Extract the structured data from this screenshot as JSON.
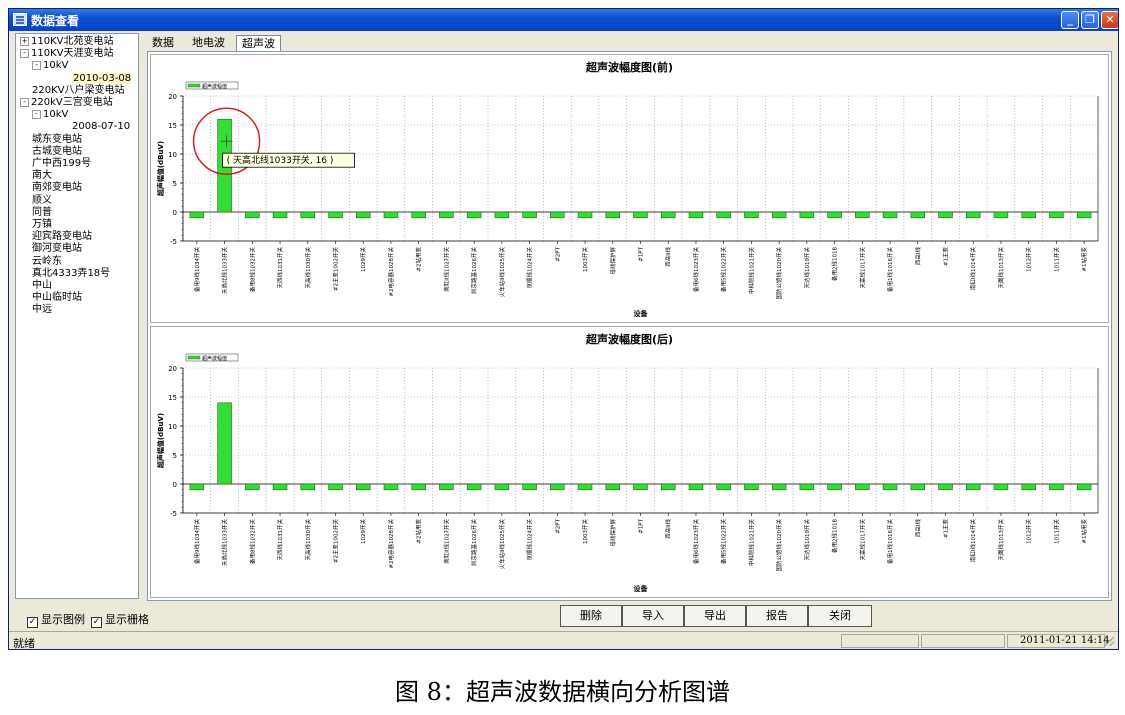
{
  "window": {
    "title": "数据查看"
  },
  "tree": [
    {
      "label": "110KV北苑变电站",
      "depth": 0,
      "toggle": "+"
    },
    {
      "label": "110KV天涯变电站",
      "depth": 0,
      "toggle": "-"
    },
    {
      "label": "10kV",
      "depth": 1,
      "toggle": "-"
    },
    {
      "label": "2010-03-08",
      "depth": 2,
      "toggle": "",
      "selected": true
    },
    {
      "label": "220KV八户梁变电站",
      "depth": 0,
      "toggle": ""
    },
    {
      "label": "220kV三宫变电站",
      "depth": 0,
      "toggle": "-"
    },
    {
      "label": "10kV",
      "depth": 1,
      "toggle": "-"
    },
    {
      "label": "2008-07-10",
      "depth": 2,
      "toggle": ""
    },
    {
      "label": "城东变电站",
      "depth": 0,
      "toggle": ""
    },
    {
      "label": "古城变电站",
      "depth": 0,
      "toggle": ""
    },
    {
      "label": "广中西199号",
      "depth": 0,
      "toggle": ""
    },
    {
      "label": "南大",
      "depth": 0,
      "toggle": ""
    },
    {
      "label": "南郊变电站",
      "depth": 0,
      "toggle": ""
    },
    {
      "label": "顺义",
      "depth": 0,
      "toggle": ""
    },
    {
      "label": "同普",
      "depth": 0,
      "toggle": ""
    },
    {
      "label": "万镇",
      "depth": 0,
      "toggle": ""
    },
    {
      "label": "迎宾路变电站",
      "depth": 0,
      "toggle": ""
    },
    {
      "label": "御河变电站",
      "depth": 0,
      "toggle": ""
    },
    {
      "label": "云岭东",
      "depth": 0,
      "toggle": ""
    },
    {
      "label": "真北4333弄18号",
      "depth": 0,
      "toggle": ""
    },
    {
      "label": "中山",
      "depth": 0,
      "toggle": ""
    },
    {
      "label": "中山临时站",
      "depth": 0,
      "toggle": ""
    },
    {
      "label": "中远",
      "depth": 0,
      "toggle": ""
    }
  ],
  "tabs": [
    "数据",
    "地电波",
    "超声波"
  ],
  "active_tab": 2,
  "chart_data": [
    {
      "type": "bar",
      "title": "超声波幅度图(前)",
      "xlabel": "设备",
      "ylabel": "超声幅值(dBuV)",
      "ylim": [
        -5,
        20
      ],
      "yticks": [
        -5,
        0,
        5,
        10,
        15,
        20
      ],
      "grid": true,
      "legend": {
        "label": "超声波幅值",
        "placement": "top-left"
      },
      "series": [
        {
          "name": "超声波幅值",
          "color": "#33dd33"
        }
      ],
      "categories": [
        "备用9线1034开关",
        "天高北线1033开关",
        "备用8线1032开关",
        "天西线1031开关",
        "天高线1030开关",
        "#2主变1002开关",
        "1029开关",
        "#2电容器1028开关",
        "#2站用变",
        "南缸II线1027开关",
        "凯京路基1026开关",
        "火车站II线1025开关",
        "京顺线1024开关",
        "#2PT",
        "1003开关",
        "母线保护屏",
        "#1PT",
        "西岳II线",
        "备用6线1023开关",
        "备用5线1022开关",
        "中科院线1021开关",
        "国防公馆线1020开关",
        "天达线1019开关",
        "备用2线1018",
        "天富线1017开关",
        "备用1线1016开关",
        "西岳I线",
        "#1主变",
        "南缸I线1014开关",
        "天鹰线1013开关",
        "1012开关",
        "1011开关",
        "#1站用变"
      ],
      "values": [
        -1,
        16,
        -1,
        -1,
        -1,
        -1,
        -1,
        -1,
        -1,
        -1,
        -1,
        -1,
        -1,
        -1,
        -1,
        -1,
        -1,
        -1,
        -1,
        -1,
        -1,
        -1,
        -1,
        -1,
        -1,
        -1,
        -1,
        -1,
        -1,
        -1,
        -1,
        -1,
        -1
      ],
      "annotation": {
        "text": "( 天高北线1033开关, 16 )",
        "target_index": 1
      }
    },
    {
      "type": "bar",
      "title": "超声波幅度图(后)",
      "xlabel": "设备",
      "ylabel": "超声幅值(dBuV)",
      "ylim": [
        -5,
        20
      ],
      "yticks": [
        -5,
        0,
        5,
        10,
        15,
        20
      ],
      "grid": true,
      "legend": {
        "label": "超声波幅值",
        "placement": "top-left"
      },
      "series": [
        {
          "name": "超声波幅值",
          "color": "#33dd33"
        }
      ],
      "categories": [
        "备用9线1034开关",
        "天高北线1033开关",
        "备用8线1032开关",
        "天西线1031开关",
        "天高线1030开关",
        "#2主变1002开关",
        "1029开关",
        "#2电容器1028开关",
        "#2站用变",
        "南缸II线1027开关",
        "凯京路基1026开关",
        "火车站II线1025开关",
        "京顺线1024开关",
        "#2PT",
        "1003开关",
        "母线保护屏",
        "#1PT",
        "西岳II线",
        "备用6线1023开关",
        "备用5线1022开关",
        "中科院线1021开关",
        "国防公馆线1020开关",
        "天达线1019开关",
        "备用2线1018",
        "天富线1017开关",
        "备用1线1016开关",
        "西岳I线",
        "#1主变",
        "南缸I线1014开关",
        "天鹰线1013开关",
        "1012开关",
        "1011开关",
        "#1站用变"
      ],
      "values": [
        -1,
        14,
        -1,
        -1,
        -1,
        -1,
        -1,
        -1,
        -1,
        -1,
        -1,
        -1,
        -1,
        -1,
        -1,
        -1,
        -1,
        -1,
        -1,
        -1,
        -1,
        -1,
        -1,
        -1,
        -1,
        -1,
        -1,
        -1,
        -1,
        -1,
        -1,
        -1,
        -1
      ]
    }
  ],
  "bottom": {
    "show_legend": {
      "label": "显示图例",
      "checked": true
    },
    "show_grid": {
      "label": "显示栅格",
      "checked": true
    },
    "buttons": {
      "delete": "删除",
      "import": "导入",
      "export": "导出",
      "report": "报告",
      "close": "关闭"
    }
  },
  "status": {
    "text": "就绪",
    "datetime": "2011-01-21 14:14"
  },
  "caption": "图 8：超声波数据横向分析图谱"
}
